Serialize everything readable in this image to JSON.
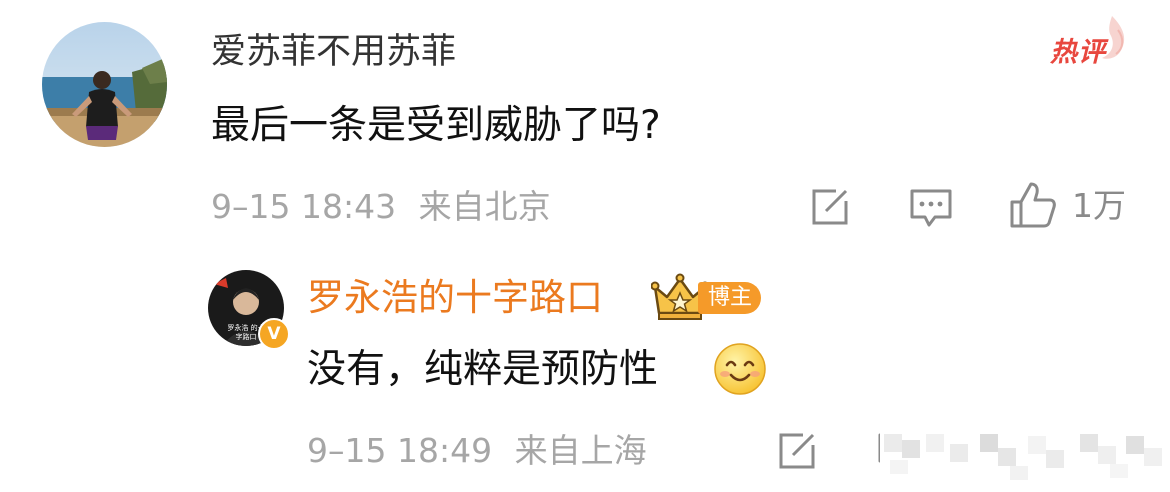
{
  "comment": {
    "username": "爱苏菲不用苏菲",
    "text": "最后一条是受到威胁了吗?",
    "time": "9–15 18:43",
    "location": "来自北京",
    "hot_badge": "热评",
    "like_count": "1万"
  },
  "reply": {
    "username": "罗永浩的十字路口",
    "host_badge": "博主",
    "avatar_caption": "罗永浩 的十字路口",
    "verified_mark": "V",
    "text": "没有，纯粹是预防性",
    "time": "9–15 18:49",
    "location": "来自上海"
  },
  "colors": {
    "username_reply": "#eb7a1f",
    "hot": "#e8473e",
    "meta": "#a6a6a6",
    "badge": "#f59a29"
  },
  "icons": [
    "edit-icon",
    "comment-icon",
    "thumbs-up-icon",
    "crown-icon",
    "smile-emoji-icon"
  ]
}
